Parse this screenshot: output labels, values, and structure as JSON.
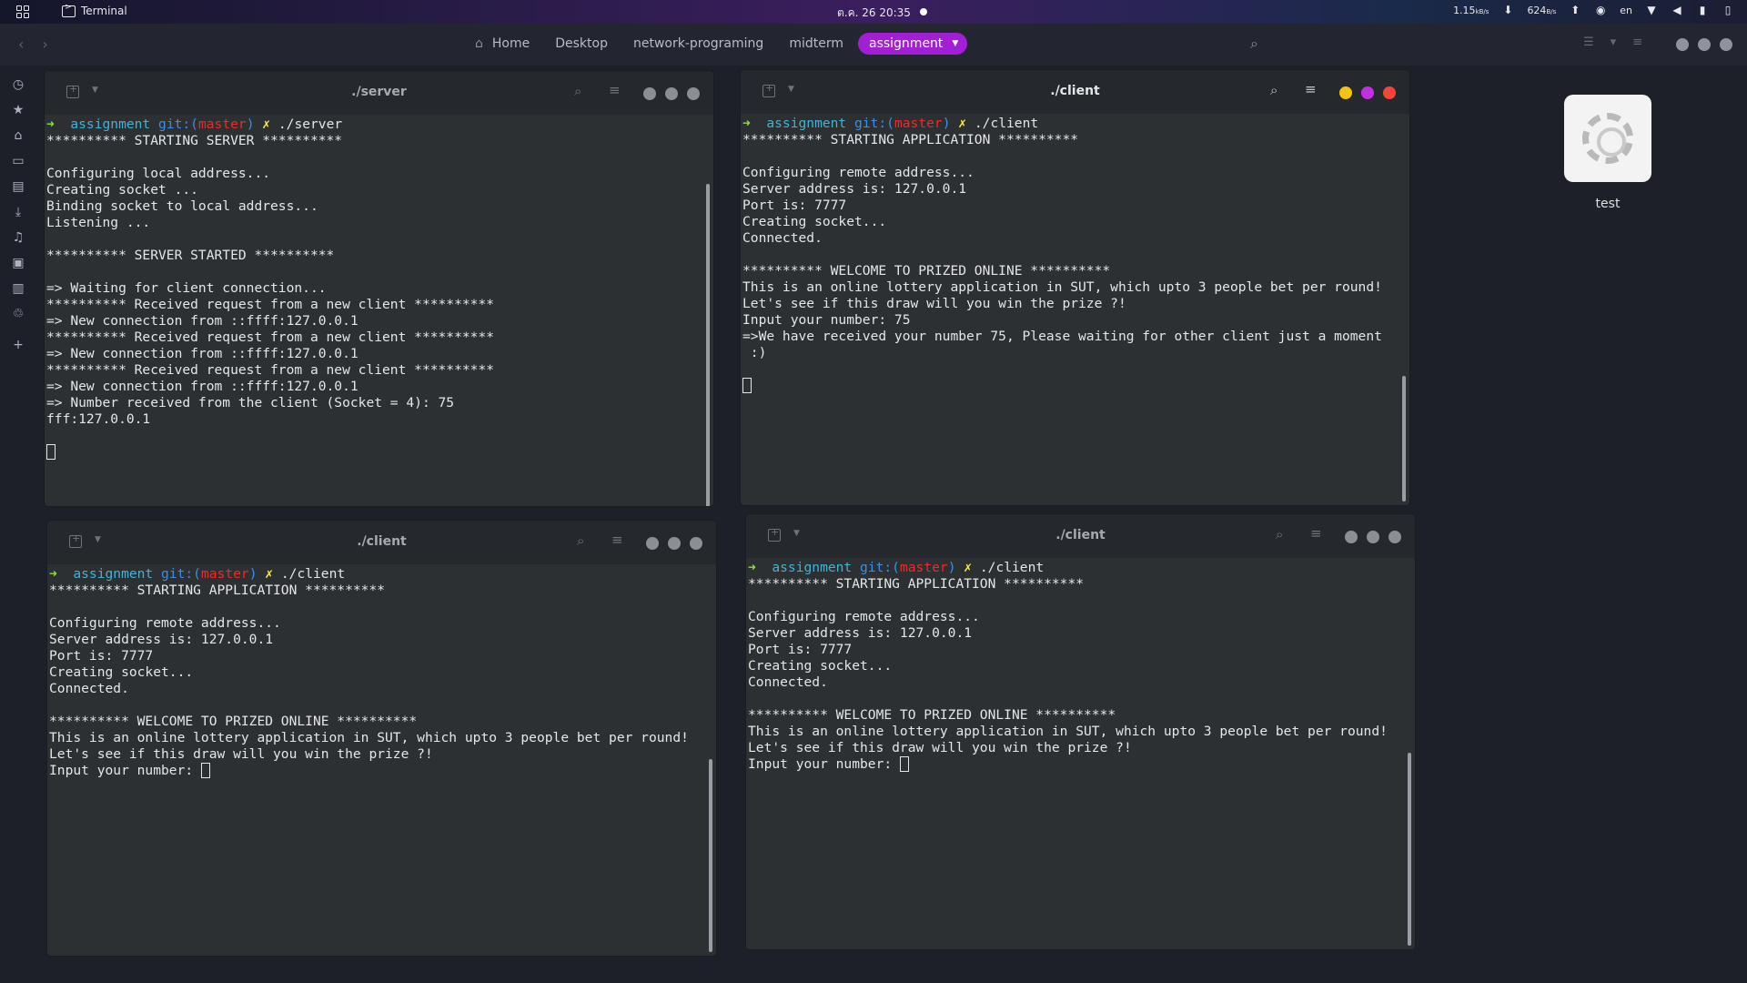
{
  "topbar": {
    "app_name": "Terminal",
    "clock": "ต.ค. 26  20:35",
    "net_down": "1.15",
    "net_down_unit": "kB/s",
    "net_up": "624",
    "net_up_unit": "B/s",
    "lang": "en"
  },
  "navbar": {
    "crumbs": [
      "Home",
      "Desktop",
      "network-programing",
      "midterm",
      "assignment"
    ]
  },
  "desktop": {
    "icon_label": "test"
  },
  "windows": {
    "server": {
      "title": "./server",
      "prompt": {
        "dir": "assignment",
        "git": "git:(",
        "branch": "master",
        "git_end": ")",
        "cmd": "./server"
      },
      "lines": [
        "********** STARTING SERVER **********",
        "",
        "Configuring local address...",
        "Creating socket ...",
        "Binding socket to local address...",
        "Listening ...",
        "",
        "********** SERVER STARTED **********",
        "",
        "=> Waiting for client connection...",
        "********** Received request from a new client **********",
        "=> New connection from ::ffff:127.0.0.1",
        "********** Received request from a new client **********",
        "=> New connection from ::ffff:127.0.0.1",
        "********** Received request from a new client **********",
        "=> New connection from ::ffff:127.0.0.1",
        "=> Number received from the client (Socket = 4): 75",
        "fff:127.0.0.1"
      ]
    },
    "client1": {
      "title": "./client",
      "prompt": {
        "dir": "assignment",
        "git": "git:(",
        "branch": "master",
        "git_end": ")",
        "cmd": "./client"
      },
      "lines": [
        "********** STARTING APPLICATION **********",
        "",
        "Configuring remote address...",
        "Server address is: 127.0.0.1",
        "Port is: 7777",
        "Creating socket...",
        "Connected.",
        "",
        "********** WELCOME TO PRIZED ONLINE **********",
        "This is an online lottery application in SUT, which upto 3 people bet per round!",
        "Let's see if this draw will you win the prize ?!",
        "Input your number: 75",
        "=>We have received your number 75, Please waiting for other client just a moment",
        " :)"
      ]
    },
    "client2": {
      "title": "./client",
      "prompt": {
        "dir": "assignment",
        "git": "git:(",
        "branch": "master",
        "git_end": ")",
        "cmd": "./client"
      },
      "lines": [
        "********** STARTING APPLICATION **********",
        "",
        "Configuring remote address...",
        "Server address is: 127.0.0.1",
        "Port is: 7777",
        "Creating socket...",
        "Connected.",
        "",
        "********** WELCOME TO PRIZED ONLINE **********",
        "This is an online lottery application in SUT, which upto 3 people bet per round!",
        "Let's see if this draw will you win the prize ?!"
      ],
      "input_prompt": "Input your number: "
    },
    "client3": {
      "title": "./client",
      "prompt": {
        "dir": "assignment",
        "git": "git:(",
        "branch": "master",
        "git_end": ")",
        "cmd": "./client"
      },
      "lines": [
        "********** STARTING APPLICATION **********",
        "",
        "Configuring remote address...",
        "Server address is: 127.0.0.1",
        "Port is: 7777",
        "Creating socket...",
        "Connected.",
        "",
        "********** WELCOME TO PRIZED ONLINE **********",
        "This is an online lottery application in SUT, which upto 3 people bet per round!",
        "Let's see if this draw will you win the prize ?!"
      ],
      "input_prompt": "Input your number: "
    }
  },
  "colors": {
    "accent": "#a21fd6",
    "terminal_bg": "#2d3033",
    "prompt_arrow": "#8ae234",
    "branch": "#ef2929"
  }
}
